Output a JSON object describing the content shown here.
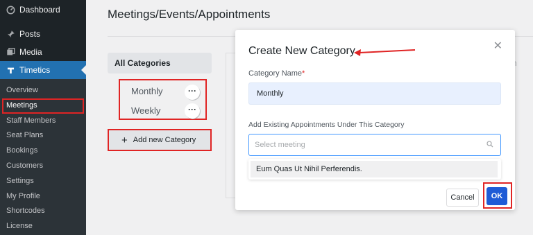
{
  "sidebar": {
    "top_items": [
      {
        "label": "Dashboard",
        "icon": "dashboard-icon"
      },
      {
        "label": "Posts",
        "icon": "pin-icon"
      },
      {
        "label": "Media",
        "icon": "media-icon"
      },
      {
        "label": "Timetics",
        "icon": "timetics-icon"
      }
    ],
    "sub_items": [
      "Overview",
      "Meetings",
      "Staff Members",
      "Seat Plans",
      "Bookings",
      "Customers",
      "Settings",
      "My Profile",
      "Shortcodes",
      "License"
    ]
  },
  "page": {
    "title": "Meetings/Events/Appointments",
    "categories_header": "All Categories",
    "categories": [
      "Monthly",
      "Weekly"
    ],
    "add_category_label": "Add new Category",
    "search_peek": "h"
  },
  "modal": {
    "title": "Create New Category",
    "category_name_label": "Category Name",
    "category_name_value": "Monthly",
    "existing_label": "Add Existing Appointments Under This Category",
    "select_placeholder": "Select meeting",
    "dropdown_option": "Eum Quas Ut Nihil Perferendis.",
    "cancel_label": "Cancel",
    "ok_label": "OK"
  },
  "colors": {
    "sidebar_bg": "#1d2327",
    "accent": "#2271b1",
    "ok_button": "#1e5bd6",
    "highlight_border": "#e02424"
  }
}
